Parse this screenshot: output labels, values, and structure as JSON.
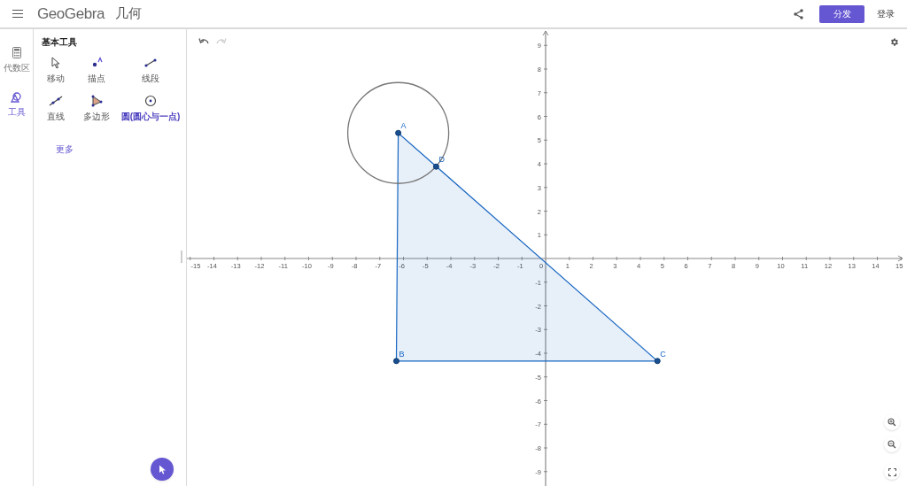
{
  "header": {
    "logo": "GeoGebra",
    "app_name": "几何",
    "share_button": "分发",
    "login": "登录"
  },
  "rail": [
    {
      "label": "代数区",
      "kind": "algebra",
      "selected": false
    },
    {
      "label": "工具",
      "kind": "tools",
      "selected": true
    }
  ],
  "tools_panel": {
    "title": "基本工具",
    "more": "更多",
    "tools": [
      {
        "label": "移动",
        "kind": "move",
        "selected": false
      },
      {
        "label": "描点",
        "kind": "point",
        "selected": false
      },
      {
        "label": "线段",
        "kind": "segment",
        "selected": false
      },
      {
        "label": "直线",
        "kind": "line",
        "selected": false
      },
      {
        "label": "多边形",
        "kind": "polygon",
        "selected": false
      },
      {
        "label": "圆(圆心与一点)",
        "kind": "circle",
        "selected": true
      }
    ]
  },
  "graphics": {
    "x_ticks": [
      "-15",
      "-14",
      "-13",
      "-12",
      "-11",
      "-10",
      "-9",
      "-8",
      "-7",
      "-6",
      "-5",
      "-4",
      "-3",
      "-2",
      "-1",
      "0",
      "1",
      "2",
      "3",
      "4",
      "5",
      "6",
      "7",
      "8",
      "9",
      "10",
      "11",
      "12",
      "13",
      "14",
      "15"
    ],
    "y_ticks": [
      "9",
      "8",
      "7",
      "6",
      "5",
      "4",
      "3",
      "2",
      "1",
      "-1",
      "-2",
      "-3",
      "-4",
      "-5",
      "-6",
      "-7",
      "-8",
      "-9"
    ],
    "points": [
      {
        "label": "A"
      },
      {
        "label": "B"
      },
      {
        "label": "C"
      },
      {
        "label": "D"
      }
    ]
  }
}
